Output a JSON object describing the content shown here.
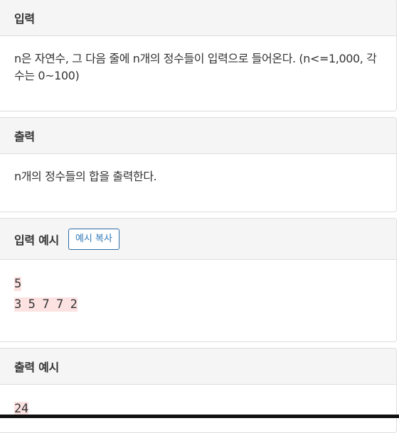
{
  "sections": {
    "input": {
      "title": "입력",
      "body": "n은 자연수, 그 다음 줄에 n개의 정수들이 입력으로 들어온다. (n<=1,000, 각 수는 0~100)"
    },
    "output": {
      "title": "출력",
      "body": "n개의 정수들의 합을 출력한다."
    },
    "sample_input": {
      "title": "입력 예시",
      "copy_label": "예시 복사",
      "lines": [
        "5",
        "3 5 7 7 2"
      ]
    },
    "sample_output": {
      "title": "출력 예시",
      "lines": [
        "24"
      ]
    }
  },
  "colors": {
    "header_bg": "#f5f5f5",
    "border": "#dddddd",
    "button_text": "#337ab7",
    "highlight_bg": "#fde2e2"
  }
}
